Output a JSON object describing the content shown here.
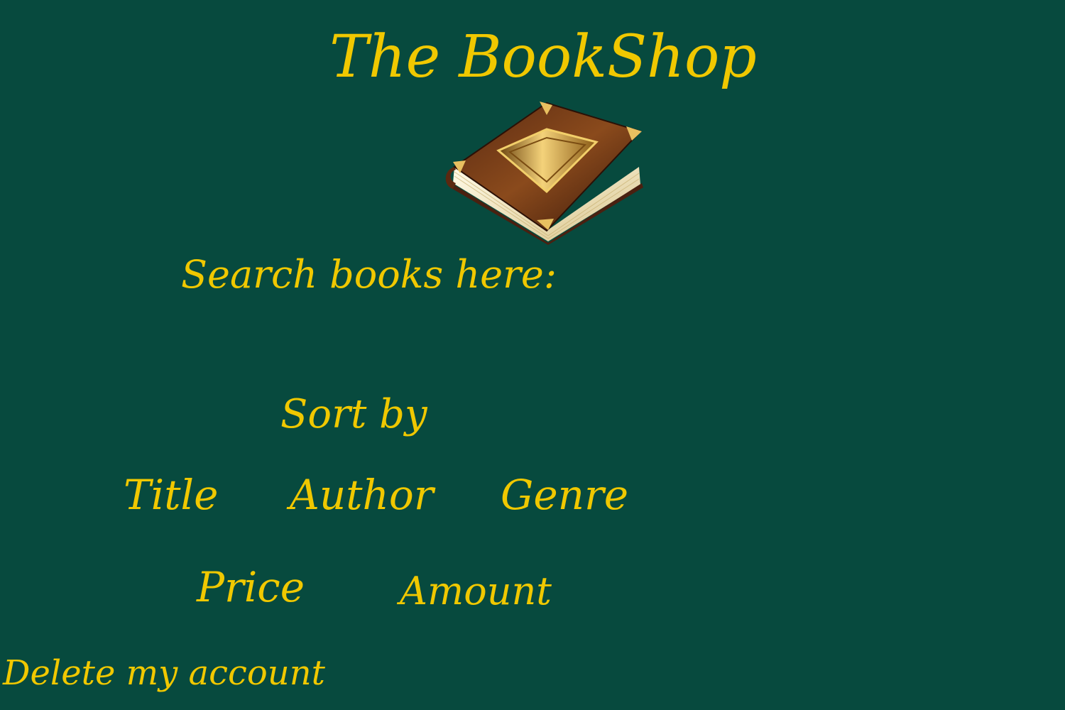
{
  "header": {
    "title": "The BookShop",
    "logo_icon": "leather-book-icon"
  },
  "search": {
    "label": "Search books here:"
  },
  "sort": {
    "label": "Sort by",
    "options": [
      "Title",
      "Author",
      "Genre",
      "Price",
      "Amount"
    ]
  },
  "account": {
    "delete_label": "Delete my account"
  },
  "colors": {
    "background": "#074a3e",
    "text": "#f0c800"
  }
}
